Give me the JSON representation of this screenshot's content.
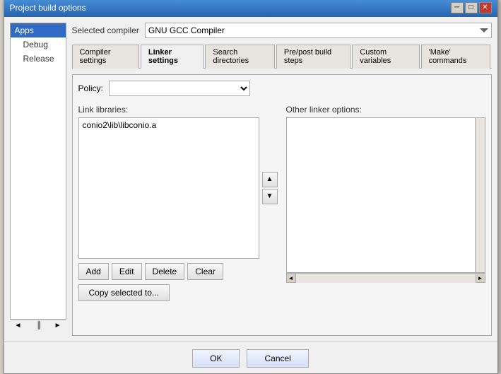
{
  "window": {
    "title": "Project build options",
    "controls": {
      "minimize": "─",
      "maximize": "□",
      "close": "✕"
    }
  },
  "sidebar": {
    "items": [
      {
        "label": "Apps",
        "level": "top",
        "selected": true
      },
      {
        "label": "Debug",
        "level": "child",
        "selected": false
      },
      {
        "label": "Release",
        "level": "child",
        "selected": false
      }
    ],
    "scroll_left": "◄",
    "scroll_spacer": "▐",
    "scroll_right": "►"
  },
  "compiler": {
    "label": "Selected compiler",
    "value": "GNU GCC Compiler",
    "options": [
      "GNU GCC Compiler"
    ]
  },
  "tabs": [
    {
      "label": "Compiler settings",
      "active": false
    },
    {
      "label": "Linker settings",
      "active": true
    },
    {
      "label": "Search directories",
      "active": false
    },
    {
      "label": "Pre/post build steps",
      "active": false
    },
    {
      "label": "Custom variables",
      "active": false
    },
    {
      "label": "'Make' commands",
      "active": false
    }
  ],
  "linker": {
    "policy_label": "Policy:",
    "link_libraries_label": "Link libraries:",
    "link_libraries_items": [
      "conio2\\lib\\libconio.a"
    ],
    "other_linker_label": "Other linker options:",
    "buttons": {
      "add": "Add",
      "edit": "Edit",
      "delete": "Delete",
      "clear": "Clear",
      "copy_selected": "Copy selected to..."
    },
    "move_up": "▲",
    "move_down": "▼"
  },
  "footer": {
    "ok": "OK",
    "cancel": "Cancel"
  }
}
